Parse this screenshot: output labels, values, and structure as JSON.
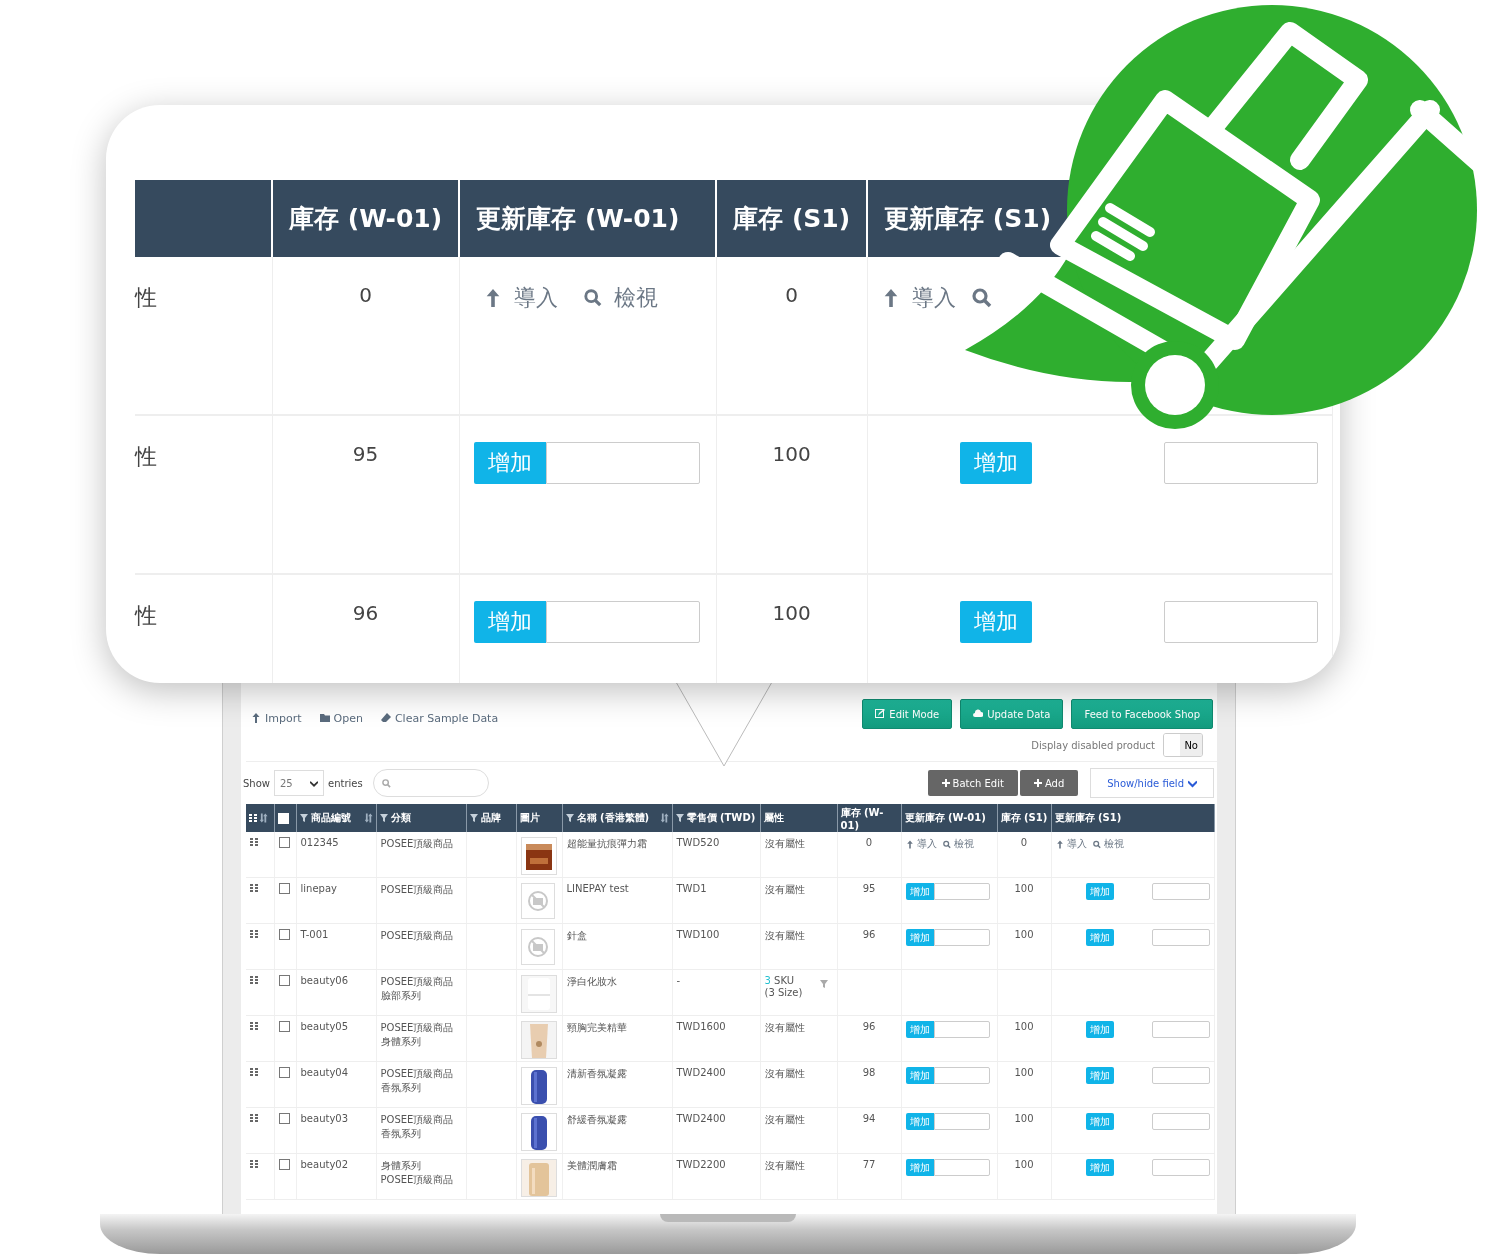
{
  "toolbar": {
    "links": [
      {
        "kind": "import",
        "label": "Import"
      },
      {
        "kind": "open",
        "label": "Open"
      },
      {
        "kind": "clear",
        "label": "Clear Sample Data"
      }
    ],
    "buttons": [
      {
        "kind": "edit",
        "label": "Edit Mode"
      },
      {
        "kind": "update",
        "label": "Update Data"
      },
      {
        "kind": "feed",
        "label": "Feed to Facebook Shop"
      }
    ],
    "disabled_toggle": {
      "label": "Display disabled product",
      "value": "No",
      "on": false
    }
  },
  "list_controls": {
    "show": "Show",
    "page_size": "25",
    "entries": "entries",
    "actions": [
      {
        "label": "Batch Edit"
      },
      {
        "label": "Add"
      }
    ],
    "column_toggle": "Show/hide field"
  },
  "table": {
    "columns": [
      {
        "kind": "drag"
      },
      {
        "kind": "check",
        "checked": false
      },
      {
        "kind": "text",
        "label": "商品編號",
        "filter": true,
        "sort": true
      },
      {
        "kind": "text",
        "label": "分類",
        "filter": true,
        "sort": false
      },
      {
        "kind": "text",
        "label": "品牌",
        "filter": true,
        "sort": false
      },
      {
        "kind": "text",
        "label": "圖片",
        "filter": false,
        "sort": false
      },
      {
        "kind": "text",
        "label": "名稱 (香港繁體)",
        "filter": true,
        "sort": true
      },
      {
        "kind": "text",
        "label": "零售價 (TWD)",
        "filter": true,
        "sort": false
      },
      {
        "kind": "text",
        "label": "屬性",
        "filter": false,
        "sort": false
      },
      {
        "kind": "text",
        "label": "庫存 (W-01)",
        "filter": false,
        "sort": false
      },
      {
        "kind": "text",
        "label": "更新庫存 (W-01)",
        "filter": false,
        "sort": false
      },
      {
        "kind": "text",
        "label": "庫存 (S1)",
        "filter": false,
        "sort": false
      },
      {
        "kind": "text",
        "label": "更新庫存 (S1)",
        "filter": false,
        "sort": false
      }
    ],
    "rows": [
      {
        "checked": false,
        "sku": "012345",
        "category": [
          "POSEE頂級商品"
        ],
        "image": {
          "kind": "picture"
        },
        "name": "超能量抗痕彈力霜",
        "price": "TWD520",
        "attribute": {
          "kind": "text",
          "text": "沒有屬性"
        },
        "stock_w01": "0",
        "update_w01": {
          "kind": "links",
          "import": "導入",
          "view": "檢視"
        },
        "stock_s1": "0",
        "update_s1": {
          "kind": "links",
          "import": "導入",
          "view": "檢視"
        }
      },
      {
        "checked": false,
        "sku": "linepay",
        "category": [
          "POSEE頂級商品"
        ],
        "image": {
          "kind": "none"
        },
        "name": "LINEPAY test",
        "price": "TWD1",
        "attribute": {
          "kind": "text",
          "text": "沒有屬性"
        },
        "stock_w01": "95",
        "update_w01": {
          "kind": "add",
          "button": "增加"
        },
        "stock_s1": "100",
        "update_s1": {
          "kind": "add",
          "button": "增加"
        }
      },
      {
        "checked": false,
        "sku": "T-001",
        "category": [
          "POSEE頂級商品"
        ],
        "image": {
          "kind": "none"
        },
        "name": "針盒",
        "price": "TWD100",
        "attribute": {
          "kind": "text",
          "text": "沒有屬性"
        },
        "stock_w01": "96",
        "update_w01": {
          "kind": "add",
          "button": "增加"
        },
        "stock_s1": "100",
        "update_s1": {
          "kind": "add",
          "button": "增加"
        }
      },
      {
        "checked": false,
        "sku": "beauty06",
        "category": [
          "POSEE頂級商品",
          "臉部系列"
        ],
        "image": {
          "kind": "picture"
        },
        "name": "淨白化妝水",
        "price": "-",
        "attribute": {
          "kind": "sku",
          "count": "3",
          "unit": "SKU",
          "detail": "(3 Size)"
        }
      },
      {
        "checked": false,
        "sku": "beauty05",
        "category": [
          "POSEE頂級商品",
          "身體系列"
        ],
        "image": {
          "kind": "picture"
        },
        "name": "頸胸完美精華",
        "price": "TWD1600",
        "attribute": {
          "kind": "text",
          "text": "沒有屬性"
        },
        "stock_w01": "96",
        "update_w01": {
          "kind": "add",
          "button": "增加"
        },
        "stock_s1": "100",
        "update_s1": {
          "kind": "add",
          "button": "增加"
        }
      },
      {
        "checked": false,
        "sku": "beauty04",
        "category": [
          "POSEE頂級商品",
          "香氛系列"
        ],
        "image": {
          "kind": "picture"
        },
        "name": "清新香氛凝露",
        "price": "TWD2400",
        "attribute": {
          "kind": "text",
          "text": "沒有屬性"
        },
        "stock_w01": "98",
        "update_w01": {
          "kind": "add",
          "button": "增加"
        },
        "stock_s1": "100",
        "update_s1": {
          "kind": "add",
          "button": "增加"
        }
      },
      {
        "checked": false,
        "sku": "beauty03",
        "category": [
          "POSEE頂級商品",
          "香氛系列"
        ],
        "image": {
          "kind": "picture"
        },
        "name": "舒緩香氛凝露",
        "price": "TWD2400",
        "attribute": {
          "kind": "text",
          "text": "沒有屬性"
        },
        "stock_w01": "94",
        "update_w01": {
          "kind": "add",
          "button": "增加"
        },
        "stock_s1": "100",
        "update_s1": {
          "kind": "add",
          "button": "增加"
        }
      },
      {
        "checked": false,
        "sku": "beauty02",
        "category": [
          "身體系列",
          "POSEE頂級商品"
        ],
        "image": {
          "kind": "picture"
        },
        "name": "美體潤膚霜",
        "price": "TWD2200",
        "attribute": {
          "kind": "text",
          "text": "沒有屬性"
        },
        "stock_w01": "77",
        "update_w01": {
          "kind": "add",
          "button": "增加"
        },
        "stock_s1": "100",
        "update_s1": {
          "kind": "add",
          "button": "增加"
        }
      }
    ]
  },
  "callout": {
    "columns": [
      {
        "kind": "blank"
      },
      {
        "kind": "text",
        "label": "庫存 (W-01)"
      },
      {
        "kind": "text",
        "label": "更新庫存 (W-01)"
      },
      {
        "kind": "text",
        "label": "庫存 (S1)"
      },
      {
        "kind": "text",
        "label": "更新庫存 (S1)"
      }
    ],
    "rows": [
      {
        "attribute": "性",
        "stock_w01": "0",
        "update_w01": {
          "kind": "links",
          "import": "導入",
          "view": "檢視"
        },
        "stock_s1": "0",
        "update_s1": {
          "kind": "links",
          "import": "導入"
        }
      },
      {
        "attribute": "性",
        "stock_w01": "95",
        "update_w01": {
          "kind": "add",
          "button": "增加"
        },
        "stock_s1": "100",
        "update_s1": {
          "kind": "add",
          "button": "增加"
        }
      },
      {
        "attribute": "性",
        "stock_w01": "96",
        "update_w01": {
          "kind": "add",
          "button": "增加"
        },
        "stock_s1": "100",
        "update_s1": {
          "kind": "add",
          "button": "增加"
        }
      }
    ]
  }
}
